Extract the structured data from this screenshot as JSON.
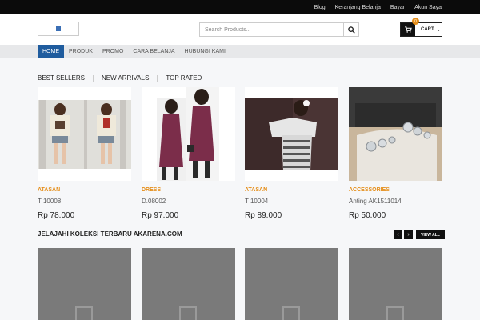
{
  "topbar": {
    "links": [
      "Blog",
      "Keranjang Belanja",
      "Bayar",
      "Akun Saya"
    ]
  },
  "search": {
    "placeholder": "Search Products..."
  },
  "cart": {
    "label": "CART",
    "count": "0"
  },
  "nav": {
    "items": [
      "HOME",
      "PRODUK",
      "PROMO",
      "CARA BELANJA",
      "HUBUNGI KAMI"
    ]
  },
  "tabs": [
    "BEST SELLERS",
    "NEW ARRIVALS",
    "TOP RATED"
  ],
  "products": [
    {
      "category": "ATASAN",
      "name": "T 10008",
      "price": "Rp 78.000"
    },
    {
      "category": "DRESS",
      "name": "D.08002",
      "price": "Rp 97.000"
    },
    {
      "category": "ATASAN",
      "name": "T 10004",
      "price": "Rp 89.000"
    },
    {
      "category": "ACCESSORIES",
      "name": "Anting AK1511014",
      "price": "Rp 50.000"
    }
  ],
  "collection": {
    "title": "JELAJAHI KOLEKSI TERBARU AKARENA.COM",
    "view_all": "VIEW ALL",
    "prev": "‹",
    "next": "›"
  },
  "colors": {
    "accent": "#e58e1a",
    "nav_active": "#1f5c9e",
    "topbar": "#0b0b0b"
  }
}
